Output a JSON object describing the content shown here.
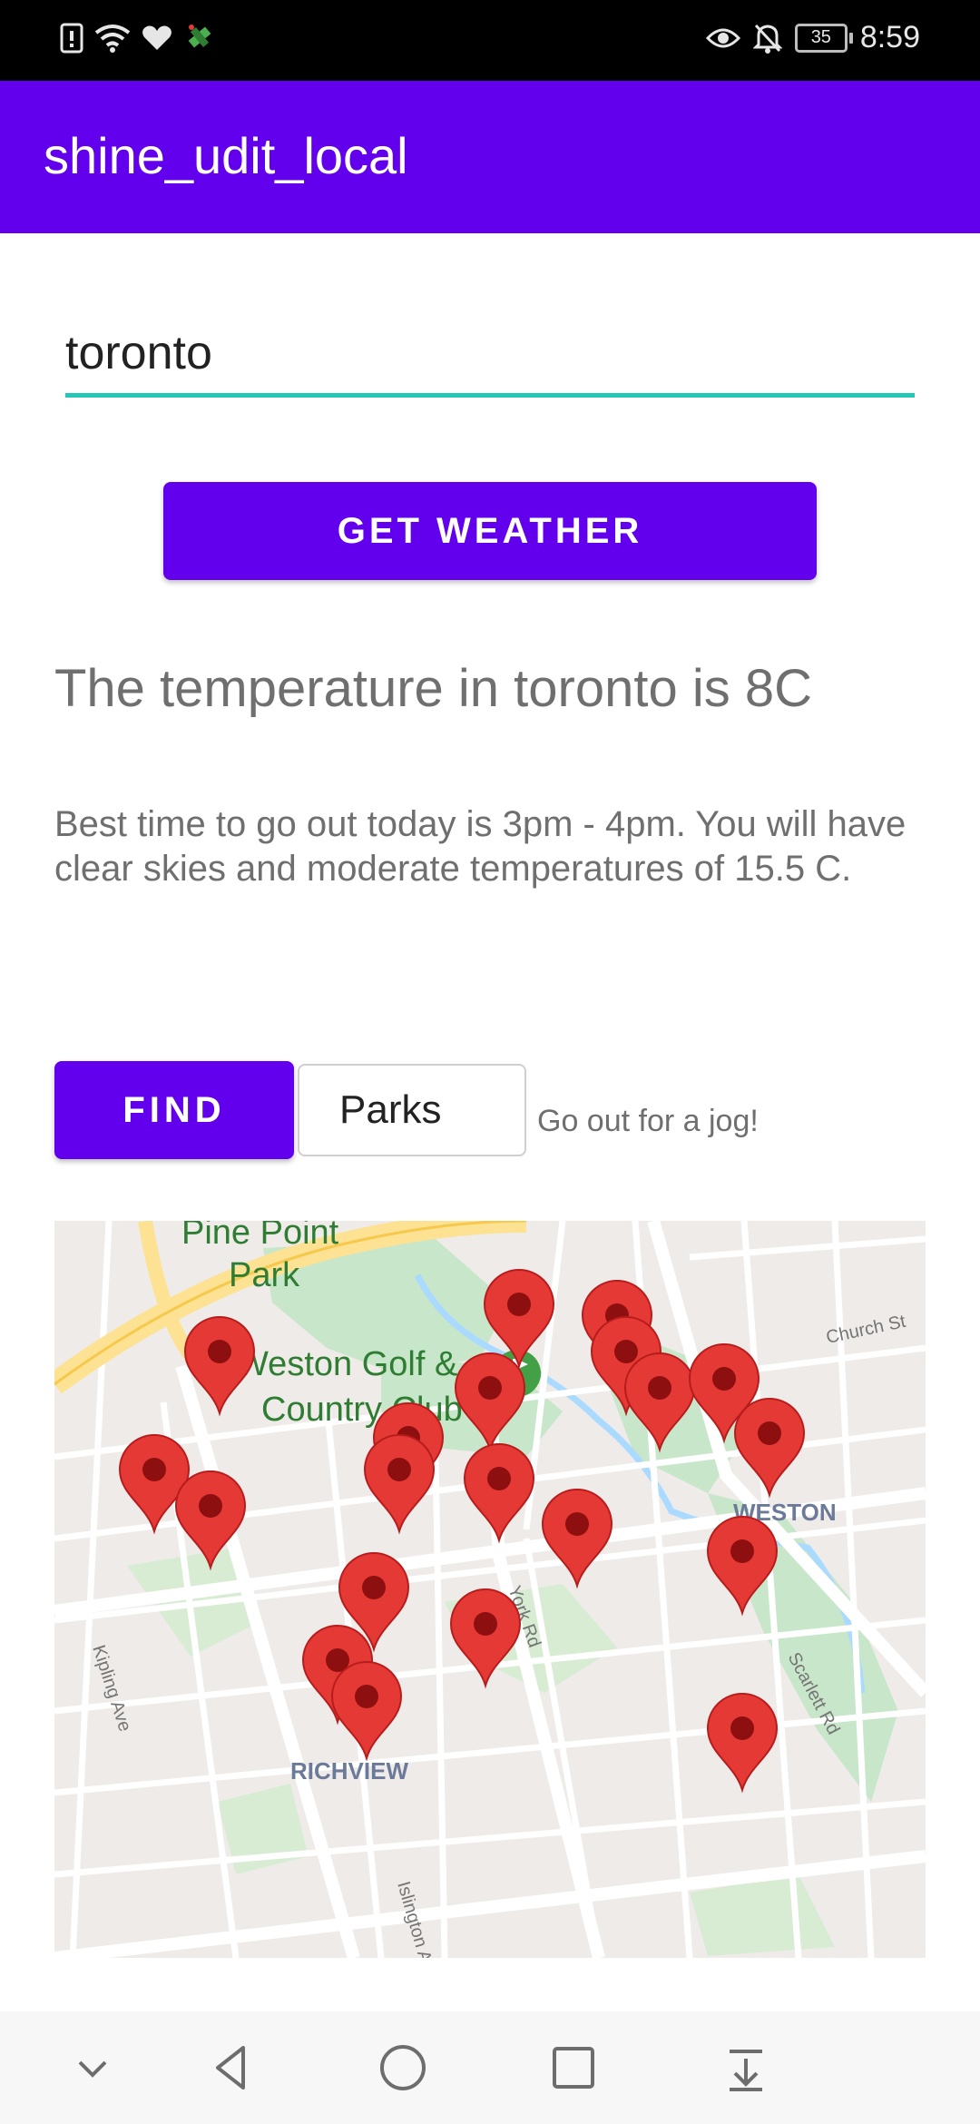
{
  "status_bar": {
    "time": "8:59",
    "battery": "35",
    "left_icons": [
      "sim-alert-icon",
      "wifi-icon",
      "heart-icon",
      "satellite-icon"
    ],
    "right_icons": [
      "eye-icon",
      "bell-off-icon",
      "battery-icon"
    ]
  },
  "app_bar": {
    "title": "shine_udit_local"
  },
  "search": {
    "city_value": "toronto"
  },
  "weather": {
    "button_label": "GET WEATHER",
    "temperature_text": "The temperature in toronto is 8C",
    "best_time_text": "Best time to go out today is 3pm - 4pm. You will have clear skies and moderate temperatures of 15.5 C."
  },
  "finder": {
    "find_label": "FIND",
    "category_value": "Parks",
    "suggestion": "Go out for a jog!"
  },
  "map": {
    "labels": {
      "pine_point": "Pine Point",
      "park": "Park",
      "golf_1": "Weston Golf &",
      "golf_2": "Country Club",
      "church_st": "Church St",
      "weston": "WESTON",
      "york_rd": "York Rd",
      "kipling": "Kipling Ave",
      "richview": "RICHVIEW",
      "scarlett": "Scarlett Rd",
      "islington": "Islington Ave"
    },
    "marker_count": 20,
    "colors": {
      "marker": "#e53935",
      "road_major": "#fde293",
      "park": "#c8e6c9",
      "water": "#aadaff"
    }
  },
  "nav_bar": {
    "icons": [
      "chevron-down-icon",
      "back-icon",
      "home-icon",
      "recents-icon",
      "notification-pull-icon"
    ]
  },
  "colors": {
    "primary": "#6200ee",
    "accent": "#26c6b6",
    "text_secondary": "#6f6f6f"
  }
}
